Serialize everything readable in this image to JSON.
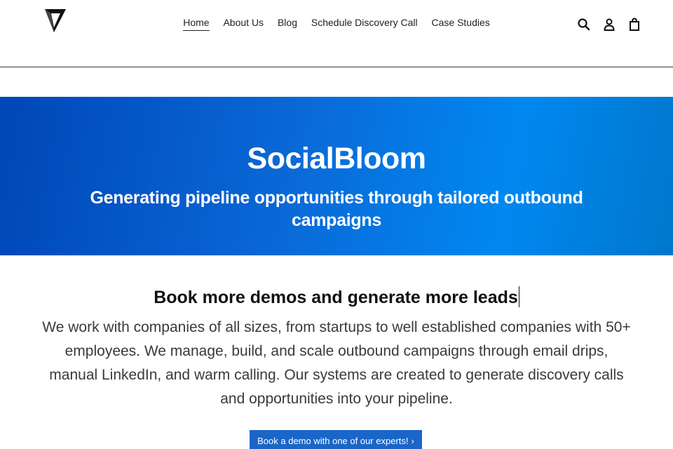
{
  "header": {
    "logo_icon": "triangle-logo-icon",
    "nav": [
      {
        "label": "Home",
        "active": true
      },
      {
        "label": "About Us",
        "active": false
      },
      {
        "label": "Blog",
        "active": false
      },
      {
        "label": "Schedule Discovery Call",
        "active": false
      },
      {
        "label": "Case Studies",
        "active": false
      }
    ],
    "icons": [
      "search-icon",
      "account-icon",
      "cart-icon"
    ]
  },
  "hero": {
    "title": "SocialBloom",
    "subtitle": "Generating pipeline opportunities through tailored outbound campaigns",
    "gradient_colors": [
      "#0046b8",
      "#0088f0"
    ]
  },
  "intro": {
    "heading": "Book more demos and generate more leads",
    "text": "We work with companies of all sizes, from startups to well established companies with 50+ employees. We manage, build, and scale outbound campaigns through email drips, manual LinkedIn, and warm calling. Our systems are created to generate discovery calls and opportunities into your pipeline."
  },
  "cta": {
    "label": "Book a demo with one of our experts!",
    "chevron": "›",
    "color": "#1a66c8"
  }
}
